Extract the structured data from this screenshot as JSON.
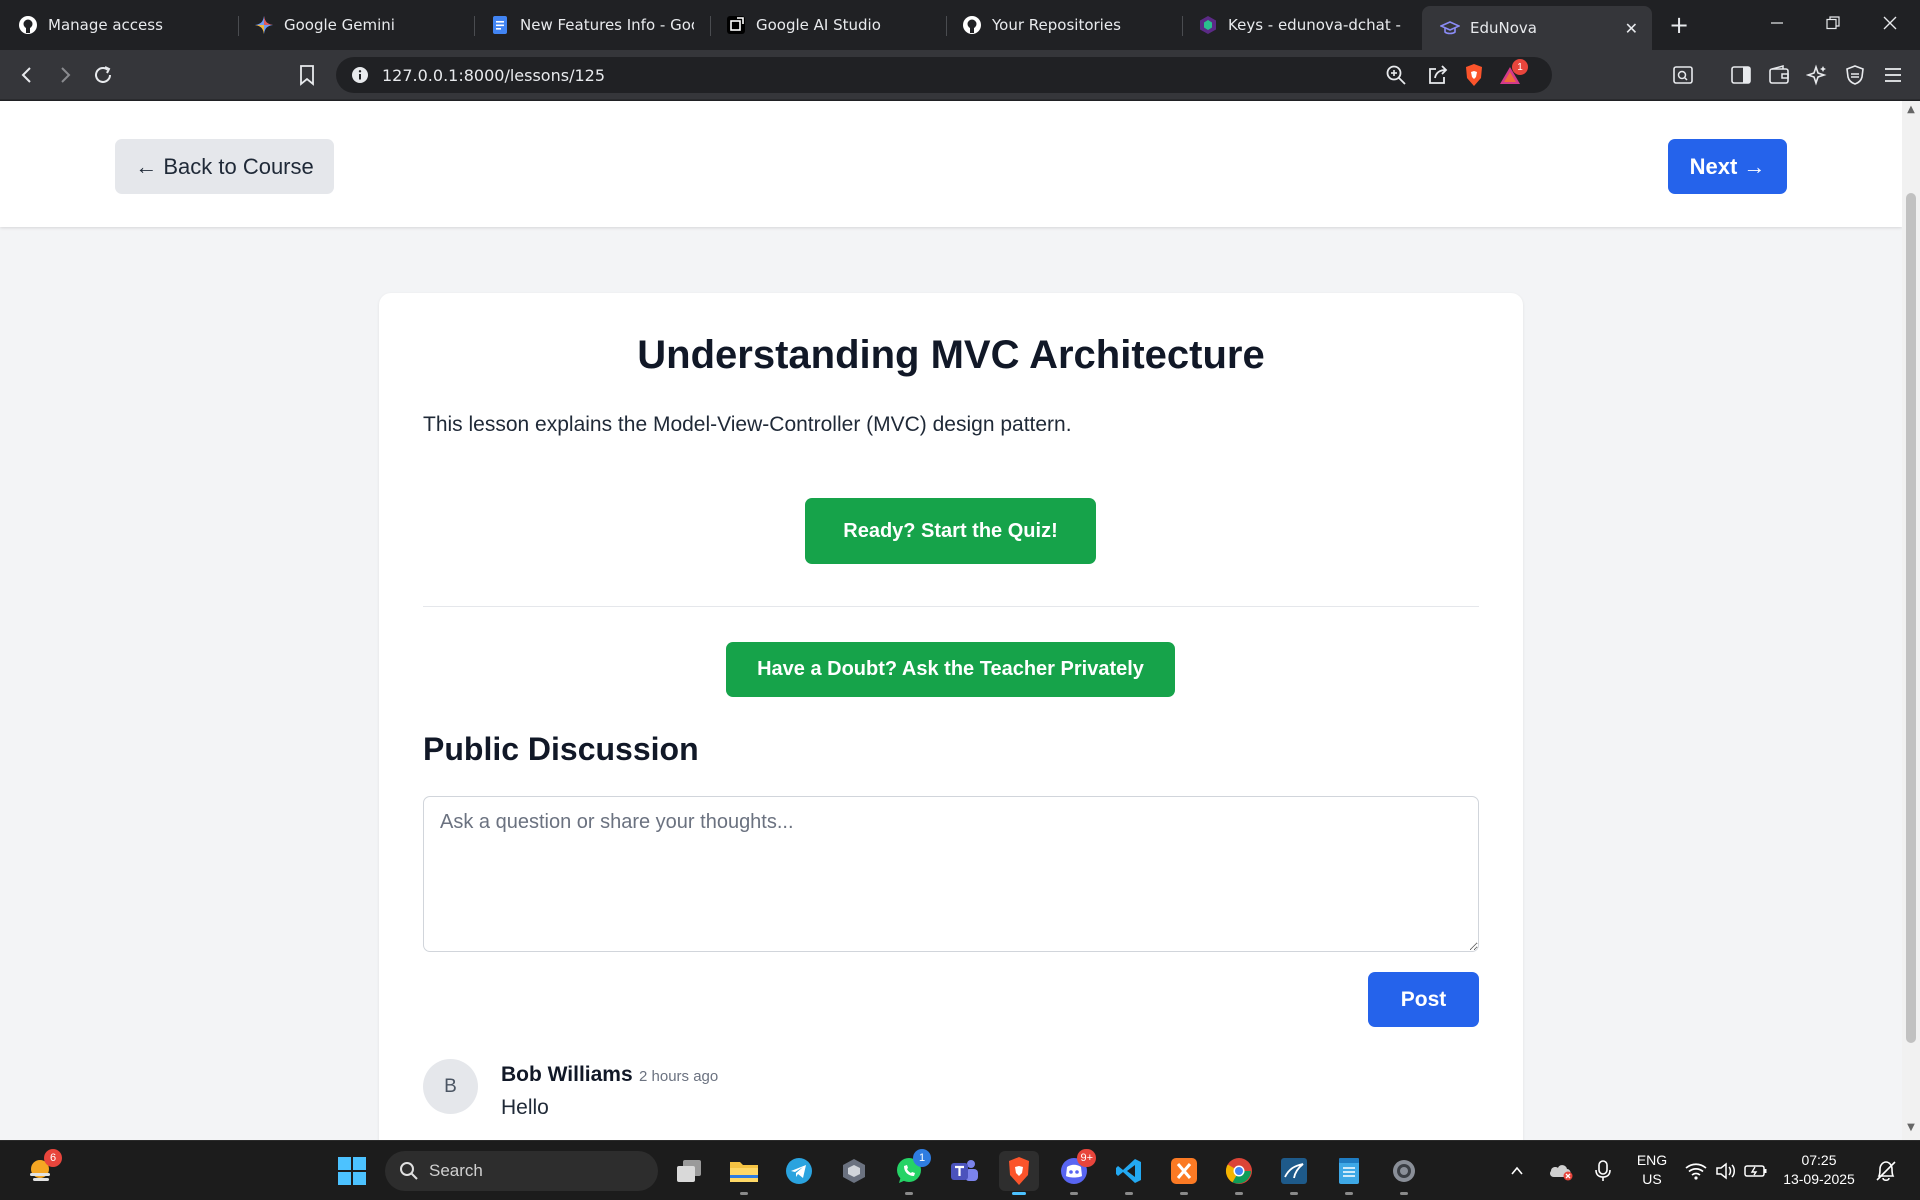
{
  "browser": {
    "tabs": [
      {
        "title": "Manage access",
        "icon": "github-icon"
      },
      {
        "title": "Google Gemini",
        "icon": "gemini-icon"
      },
      {
        "title": "New Features Info - Googl",
        "icon": "docs-icon"
      },
      {
        "title": "Google AI Studio",
        "icon": "ai-studio-icon"
      },
      {
        "title": "Your Repositories",
        "icon": "github-icon"
      },
      {
        "title": "Keys - edunova-dchat - Cl",
        "icon": "keys-icon"
      },
      {
        "title": "EduNova",
        "icon": "edunova-icon",
        "active": true
      }
    ],
    "url": "127.0.0.1:8000/lessons/125",
    "shields_badge": "1"
  },
  "page": {
    "back_label": "← Back to Course",
    "next_label": "Next →",
    "lesson_title": "Understanding MVC Architecture",
    "lesson_description": "This lesson explains the Model-View-Controller (MVC) design pattern.",
    "quiz_label": "Ready? Start the Quiz!",
    "doubt_label": "Have a Doubt? Ask the Teacher Privately",
    "discussion_title": "Public Discussion",
    "discussion_placeholder": "Ask a question or share your thoughts...",
    "post_label": "Post",
    "comments": [
      {
        "avatar_letter": "B",
        "author": "Bob Williams",
        "time": "2 hours ago",
        "body": "Hello"
      }
    ]
  },
  "taskbar": {
    "weather_badge": "6",
    "search_label": "Search",
    "whatsapp_badge": "1",
    "discord_badge": "9+",
    "language": "ENG",
    "region": "US",
    "time": "07:25",
    "date": "13-09-2025"
  },
  "colors": {
    "primary_blue": "#2563eb",
    "success_green": "#16a34a",
    "page_bg": "#f3f4f6"
  }
}
